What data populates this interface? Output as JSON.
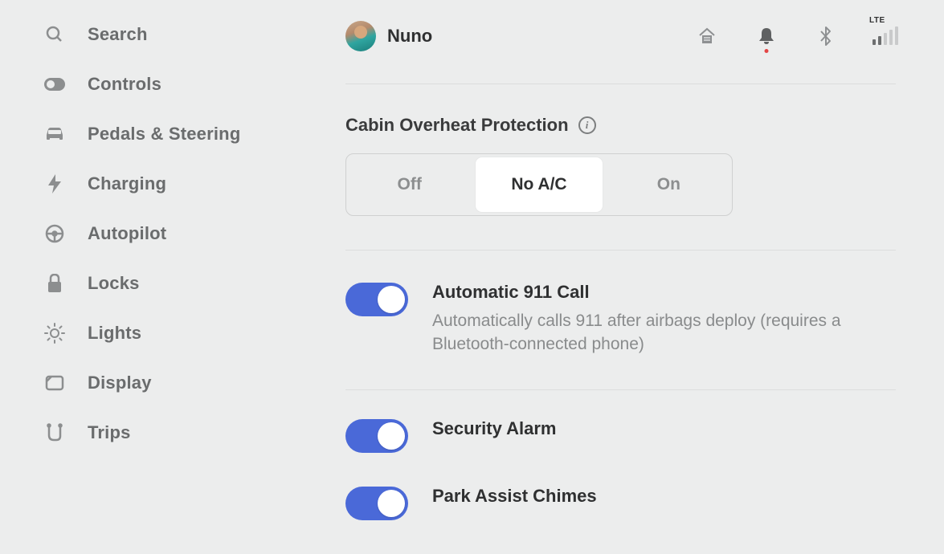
{
  "sidebar": {
    "items": [
      {
        "label": "Search",
        "icon": "search"
      },
      {
        "label": "Controls",
        "icon": "toggle"
      },
      {
        "label": "Pedals & Steering",
        "icon": "car"
      },
      {
        "label": "Charging",
        "icon": "bolt"
      },
      {
        "label": "Autopilot",
        "icon": "steer"
      },
      {
        "label": "Locks",
        "icon": "lock"
      },
      {
        "label": "Lights",
        "icon": "sun"
      },
      {
        "label": "Display",
        "icon": "display"
      },
      {
        "label": "Trips",
        "icon": "route"
      }
    ]
  },
  "header": {
    "profile_name": "Nuno",
    "signal_label": "LTE"
  },
  "settings": {
    "cop": {
      "title": "Cabin Overheat Protection",
      "options": [
        "Off",
        "No A/C",
        "On"
      ],
      "selected": "No A/C"
    },
    "auto911": {
      "title": "Automatic 911 Call",
      "desc": "Automatically calls 911 after airbags deploy (requires a Bluetooth-connected phone)",
      "on": true
    },
    "alarm": {
      "title": "Security Alarm",
      "on": true
    },
    "park_assist": {
      "title": "Park Assist Chimes",
      "on": true
    }
  }
}
